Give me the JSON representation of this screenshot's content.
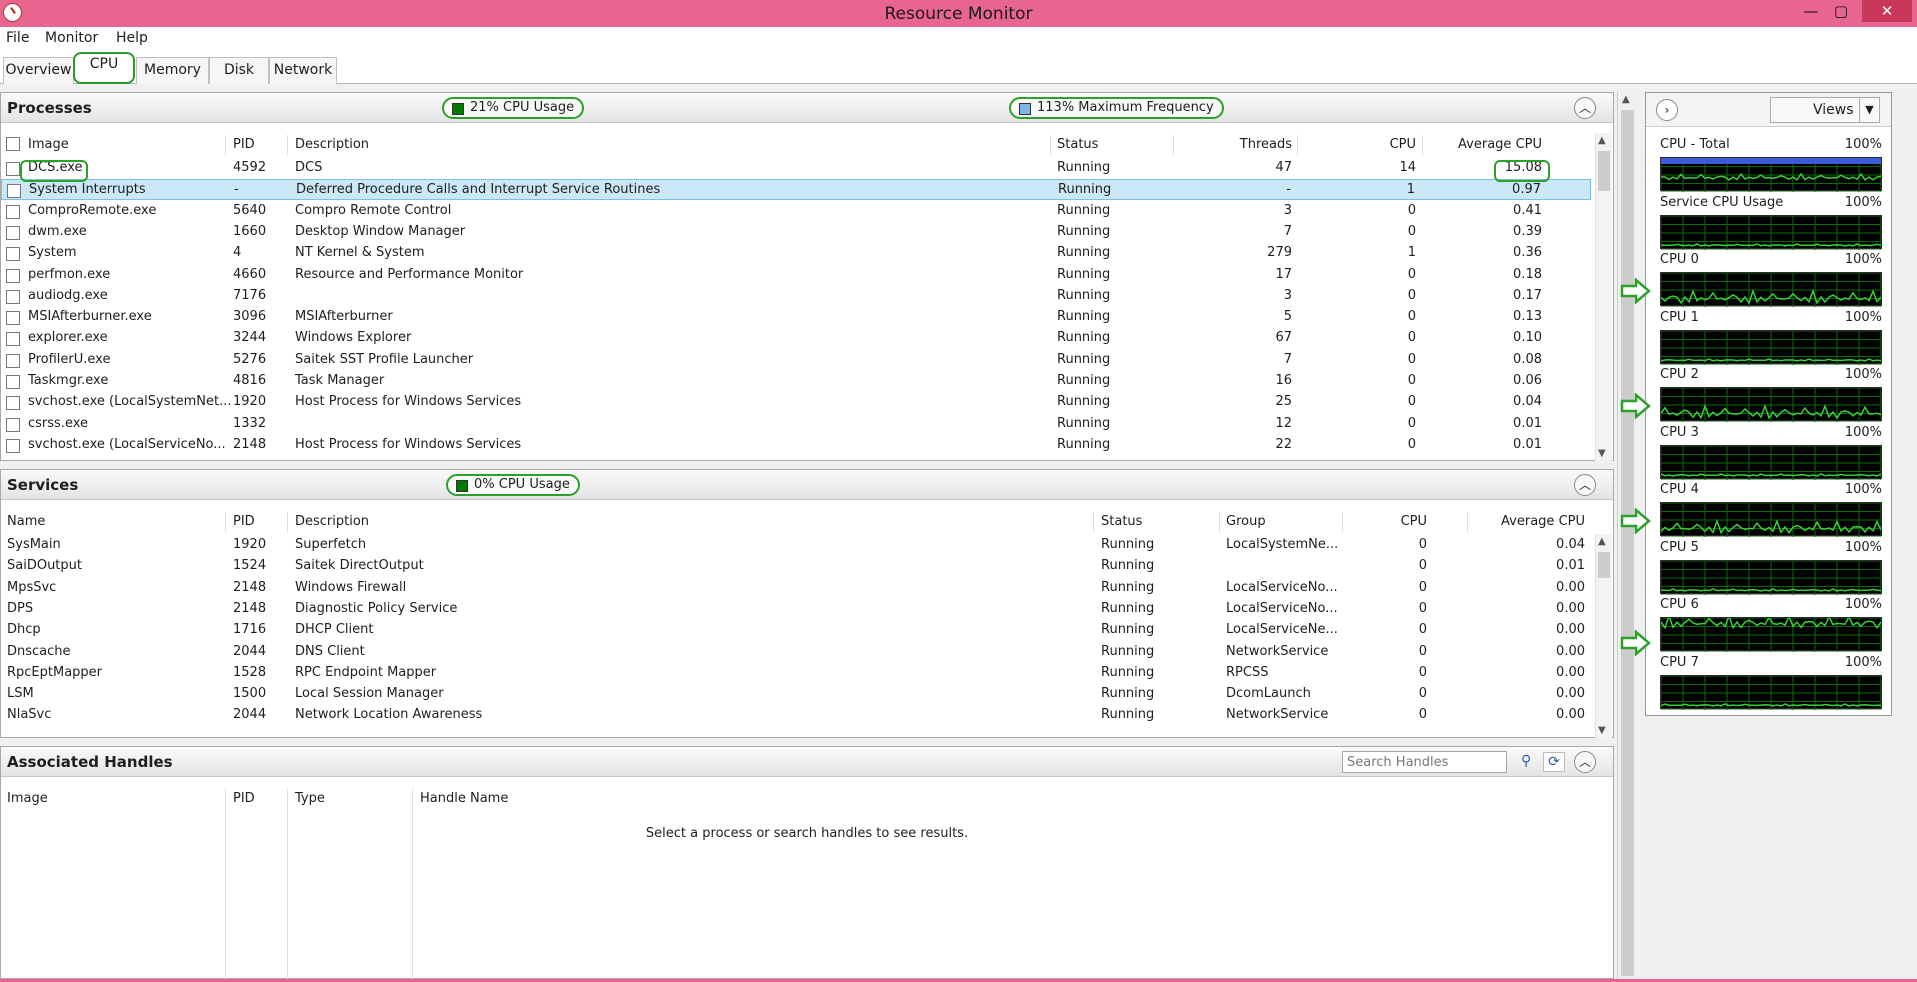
{
  "window": {
    "title": "Resource Monitor",
    "min": "—",
    "max": "▢",
    "close": "✕"
  },
  "menu": {
    "file": "File",
    "monitor": "Monitor",
    "help": "Help"
  },
  "tabs": {
    "overview": "Overview",
    "cpu": "CPU",
    "memory": "Memory",
    "disk": "Disk",
    "network": "Network"
  },
  "processes": {
    "title": "Processes",
    "badge_usage": "21% CPU Usage",
    "badge_freq": "113% Maximum Frequency",
    "headers": {
      "image": "Image",
      "pid": "PID",
      "description": "Description",
      "status": "Status",
      "threads": "Threads",
      "cpu": "CPU",
      "avg_cpu": "Average CPU"
    },
    "rows": [
      {
        "image": "DCS.exe",
        "pid": "4592",
        "description": "DCS",
        "status": "Running",
        "threads": "47",
        "cpu": "14",
        "avg_cpu": "15.08"
      },
      {
        "image": "System Interrupts",
        "pid": "-",
        "description": "Deferred Procedure Calls and Interrupt Service Routines",
        "status": "Running",
        "threads": "-",
        "cpu": "1",
        "avg_cpu": "0.97"
      },
      {
        "image": "ComproRemote.exe",
        "pid": "5640",
        "description": "Compro Remote Control",
        "status": "Running",
        "threads": "3",
        "cpu": "0",
        "avg_cpu": "0.41"
      },
      {
        "image": "dwm.exe",
        "pid": "1660",
        "description": "Desktop Window Manager",
        "status": "Running",
        "threads": "7",
        "cpu": "0",
        "avg_cpu": "0.39"
      },
      {
        "image": "System",
        "pid": "4",
        "description": "NT Kernel & System",
        "status": "Running",
        "threads": "279",
        "cpu": "1",
        "avg_cpu": "0.36"
      },
      {
        "image": "perfmon.exe",
        "pid": "4660",
        "description": "Resource and Performance Monitor",
        "status": "Running",
        "threads": "17",
        "cpu": "0",
        "avg_cpu": "0.18"
      },
      {
        "image": "audiodg.exe",
        "pid": "7176",
        "description": "",
        "status": "Running",
        "threads": "3",
        "cpu": "0",
        "avg_cpu": "0.17"
      },
      {
        "image": "MSIAfterburner.exe",
        "pid": "3096",
        "description": "MSIAfterburner",
        "status": "Running",
        "threads": "5",
        "cpu": "0",
        "avg_cpu": "0.13"
      },
      {
        "image": "explorer.exe",
        "pid": "3244",
        "description": "Windows Explorer",
        "status": "Running",
        "threads": "67",
        "cpu": "0",
        "avg_cpu": "0.10"
      },
      {
        "image": "ProfilerU.exe",
        "pid": "5276",
        "description": "Saitek SST Profile Launcher",
        "status": "Running",
        "threads": "7",
        "cpu": "0",
        "avg_cpu": "0.08"
      },
      {
        "image": "Taskmgr.exe",
        "pid": "4816",
        "description": "Task Manager",
        "status": "Running",
        "threads": "16",
        "cpu": "0",
        "avg_cpu": "0.06"
      },
      {
        "image": "svchost.exe (LocalSystemNet...",
        "pid": "1920",
        "description": "Host Process for Windows Services",
        "status": "Running",
        "threads": "25",
        "cpu": "0",
        "avg_cpu": "0.04"
      },
      {
        "image": "csrss.exe",
        "pid": "1332",
        "description": "",
        "status": "Running",
        "threads": "12",
        "cpu": "0",
        "avg_cpu": "0.01"
      },
      {
        "image": "svchost.exe (LocalServiceNo...",
        "pid": "2148",
        "description": "Host Process for Windows Services",
        "status": "Running",
        "threads": "22",
        "cpu": "0",
        "avg_cpu": "0.01"
      }
    ]
  },
  "services": {
    "title": "Services",
    "badge_usage": "0% CPU Usage",
    "headers": {
      "name": "Name",
      "pid": "PID",
      "description": "Description",
      "status": "Status",
      "group": "Group",
      "cpu": "CPU",
      "avg_cpu": "Average CPU"
    },
    "rows": [
      {
        "name": "SysMain",
        "pid": "1920",
        "description": "Superfetch",
        "status": "Running",
        "group": "LocalSystemNe...",
        "cpu": "0",
        "avg_cpu": "0.04"
      },
      {
        "name": "SaiDOutput",
        "pid": "1524",
        "description": "Saitek DirectOutput",
        "status": "Running",
        "group": "",
        "cpu": "0",
        "avg_cpu": "0.01"
      },
      {
        "name": "MpsSvc",
        "pid": "2148",
        "description": "Windows Firewall",
        "status": "Running",
        "group": "LocalServiceNo...",
        "cpu": "0",
        "avg_cpu": "0.00"
      },
      {
        "name": "DPS",
        "pid": "2148",
        "description": "Diagnostic Policy Service",
        "status": "Running",
        "group": "LocalServiceNo...",
        "cpu": "0",
        "avg_cpu": "0.00"
      },
      {
        "name": "Dhcp",
        "pid": "1716",
        "description": "DHCP Client",
        "status": "Running",
        "group": "LocalServiceNe...",
        "cpu": "0",
        "avg_cpu": "0.00"
      },
      {
        "name": "Dnscache",
        "pid": "2044",
        "description": "DNS Client",
        "status": "Running",
        "group": "NetworkService",
        "cpu": "0",
        "avg_cpu": "0.00"
      },
      {
        "name": "RpcEptMapper",
        "pid": "1528",
        "description": "RPC Endpoint Mapper",
        "status": "Running",
        "group": "RPCSS",
        "cpu": "0",
        "avg_cpu": "0.00"
      },
      {
        "name": "LSM",
        "pid": "1500",
        "description": "Local Session Manager",
        "status": "Running",
        "group": "DcomLaunch",
        "cpu": "0",
        "avg_cpu": "0.00"
      },
      {
        "name": "NlaSvc",
        "pid": "2044",
        "description": "Network Location Awareness",
        "status": "Running",
        "group": "NetworkService",
        "cpu": "0",
        "avg_cpu": "0.00"
      }
    ]
  },
  "handles": {
    "title": "Associated Handles",
    "search_placeholder": "Search Handles",
    "headers": {
      "image": "Image",
      "pid": "PID",
      "type": "Type",
      "handle_name": "Handle Name"
    },
    "empty_message": "Select a process or search handles to see results."
  },
  "right_panel": {
    "views_label": "Views",
    "graphs": [
      {
        "name": "CPU - Total",
        "pct": "100%"
      },
      {
        "name": "Service CPU Usage",
        "pct": "100%"
      },
      {
        "name": "CPU 0",
        "pct": "100%"
      },
      {
        "name": "CPU 1",
        "pct": "100%"
      },
      {
        "name": "CPU 2",
        "pct": "100%"
      },
      {
        "name": "CPU 3",
        "pct": "100%"
      },
      {
        "name": "CPU 4",
        "pct": "100%"
      },
      {
        "name": "CPU 5",
        "pct": "100%"
      },
      {
        "name": "CPU 6",
        "pct": "100%"
      },
      {
        "name": "CPU 7",
        "pct": "100%"
      }
    ]
  },
  "colors": {
    "titlebar": "#e8658f",
    "highlight": "#2ba02b",
    "graph_line": "#39d139",
    "graph_bg": "#000000",
    "total_band": "#3a5ad8"
  }
}
